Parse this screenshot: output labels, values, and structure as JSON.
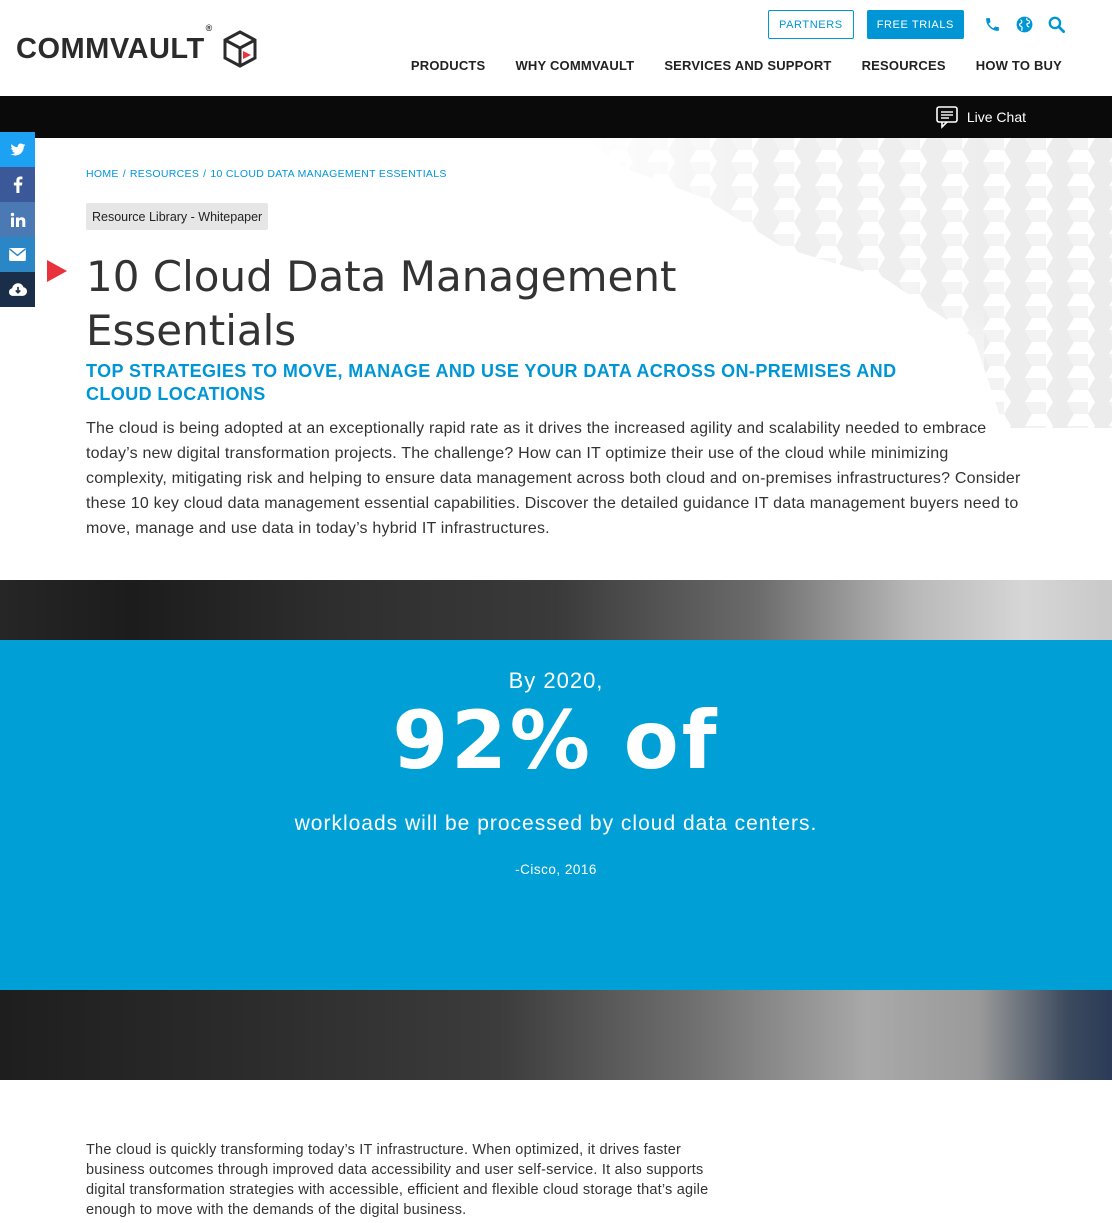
{
  "brand": {
    "name": "COMMVAULT",
    "reg": "®",
    "accent": "#0096d6",
    "dark": "#0a0a0a",
    "highlight": "#e8323c"
  },
  "utility": {
    "partners": "PARTNERS",
    "free_trials": "FREE TRIALS",
    "icons": [
      "phone-icon",
      "globe-icon",
      "search-icon"
    ]
  },
  "nav": {
    "items": [
      {
        "label": "PRODUCTS"
      },
      {
        "label": "WHY COMMVAULT"
      },
      {
        "label": "SERVICES AND SUPPORT"
      },
      {
        "label": "RESOURCES"
      },
      {
        "label": "HOW TO BUY"
      }
    ]
  },
  "live_chat": {
    "label": "Live Chat"
  },
  "social": [
    "twitter-icon",
    "facebook-icon",
    "linkedin-icon",
    "email-icon",
    "cloud-download-icon"
  ],
  "breadcrumb": {
    "home": "HOME",
    "sep": "/",
    "resources": "RESOURCES",
    "current": "10 CLOUD DATA MANAGEMENT ESSENTIALS"
  },
  "tag": "Resource Library - Whitepaper",
  "title": "10 Cloud Data Management Essentials",
  "subtitle": "TOP STRATEGIES TO MOVE, MANAGE AND USE YOUR DATA ACROSS ON-PREMISES AND CLOUD LOCATIONS",
  "intro": "The cloud is being adopted at an exceptionally rapid rate as it drives the increased agility and scalability needed to embrace today’s new digital transformation projects. The challenge? How can IT optimize their use of the cloud while minimizing complexity, mitigating risk and helping to ensure data management across both cloud and on-premises infrastructures? Consider these 10 key cloud data management essential capabilities. Discover the detailed guidance IT data management buyers need to move, manage and use data in today’s hybrid IT infrastructures.",
  "stat": {
    "lead": "By 2020,",
    "big": "92% of",
    "sub": "workloads will be processed by cloud data centers.",
    "source": "-Cisco, 2016",
    "color": "#00a0d7"
  },
  "body2": "The cloud is quickly transforming today’s IT infrastructure. When optimized, it drives faster business outcomes through improved data accessibility and user self-service. It also supports digital transformation strategies with accessible, efficient and flexible cloud storage that’s agile enough to move with the demands of the digital business."
}
